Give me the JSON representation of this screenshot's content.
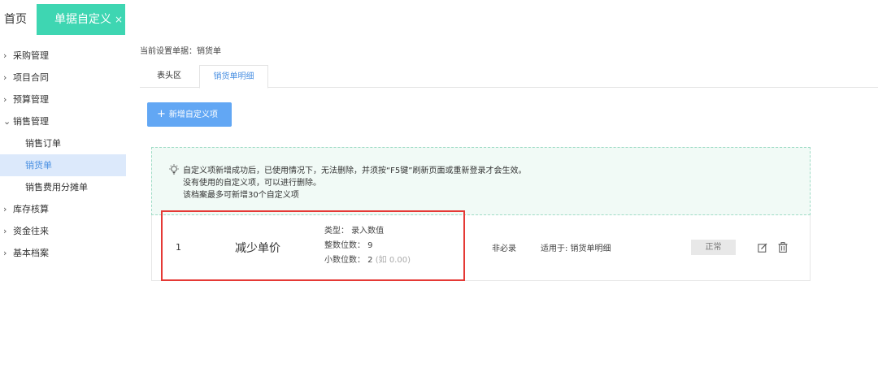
{
  "tabs_bar": {
    "home_label": "首页",
    "active_label": "单据自定义",
    "close_glyph": "×"
  },
  "sidebar": {
    "items": [
      {
        "label": "采购管理",
        "expanded": false
      },
      {
        "label": "项目合同",
        "expanded": false
      },
      {
        "label": "预算管理",
        "expanded": false
      },
      {
        "label": "销售管理",
        "expanded": true
      },
      {
        "label": "库存核算",
        "expanded": false
      },
      {
        "label": "资金往来",
        "expanded": false
      },
      {
        "label": "基本档案",
        "expanded": false
      }
    ],
    "sales_sub": [
      {
        "label": "销售订单"
      },
      {
        "label": "销货单",
        "active": true
      },
      {
        "label": "销售费用分摊单"
      }
    ],
    "chevron_right": "›",
    "chevron_down": "⌄"
  },
  "main": {
    "current_doc": "当前设置单据：销货单",
    "tab_header": "表头区",
    "tab_detail": "销货单明细",
    "add_button": "新增自定义项",
    "add_plus": "+",
    "notice": {
      "line1": "自定义项新增成功后，已使用情况下，无法删除，并须按“F5键”刷新页面或重新登录才会生效。",
      "line2": "没有使用的自定义项，可以进行删除。",
      "line3": "该档案最多可新增30个自定义项"
    },
    "row": {
      "seq": "1",
      "name": "减少单价",
      "type_line": "类型： 录入数值",
      "int_line": "整数位数： 9",
      "dec_line": "小数位数： 2",
      "dec_hint": "(如 0.00)",
      "required": "非必录",
      "apply_to": "适用于:  销货单明细",
      "status": "正常"
    }
  },
  "colors": {
    "accent_green": "#3ed6b2",
    "primary_blue": "#62a7f4",
    "link_blue": "#4a90e2",
    "highlight_red": "#e53935"
  }
}
